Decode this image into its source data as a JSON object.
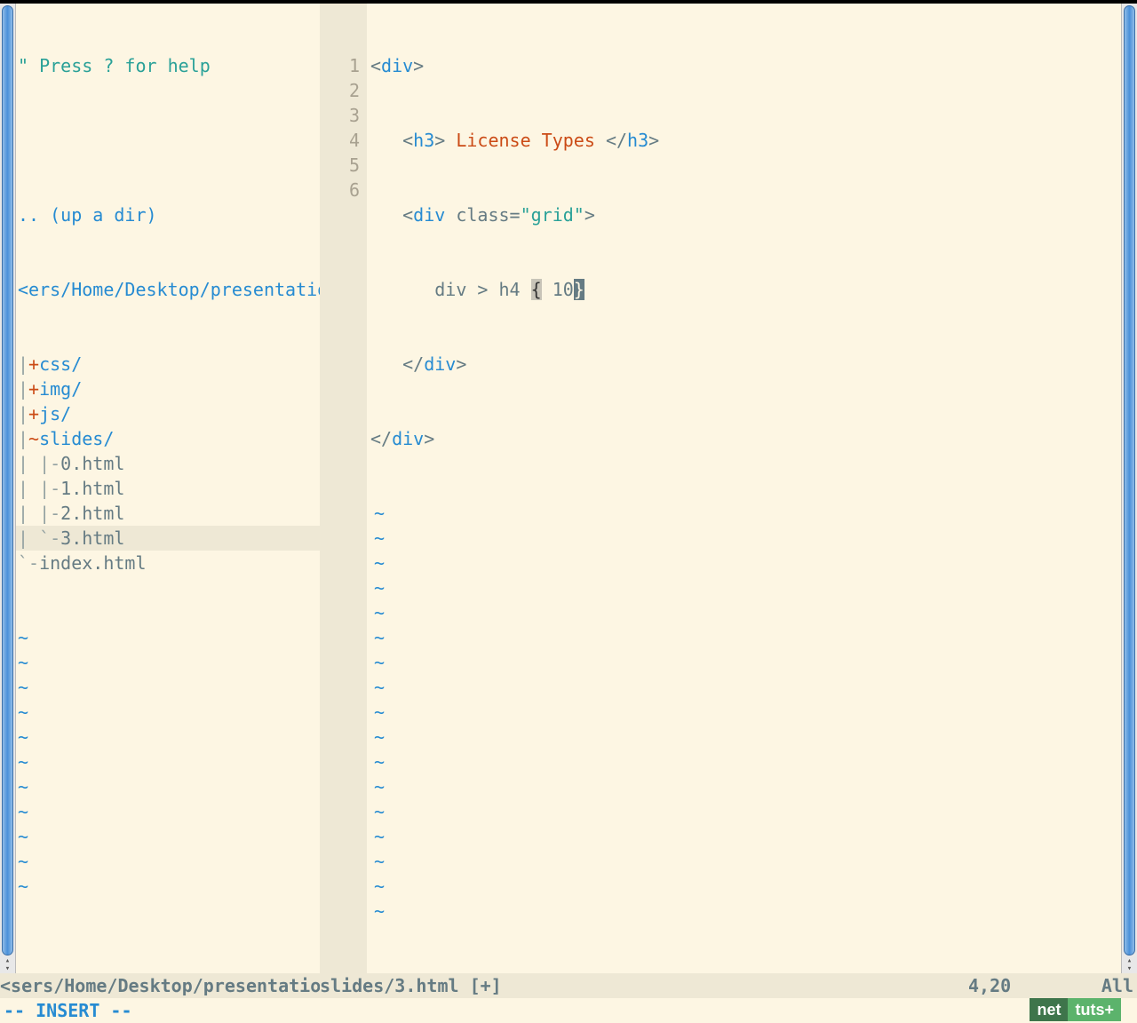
{
  "tree": {
    "help_prefix": "\" ",
    "help_text": "Press ? for help",
    "up_dir": ".. (up a dir)",
    "path": "<ers/Home/Desktop/presentation/",
    "entries": [
      {
        "prefix": "|",
        "glyph": "+",
        "name": "css/",
        "dir": true
      },
      {
        "prefix": "|",
        "glyph": "+",
        "name": "img/",
        "dir": true
      },
      {
        "prefix": "|",
        "glyph": "+",
        "name": "js/",
        "dir": true
      },
      {
        "prefix": "|",
        "glyph": "~",
        "name": "slides/",
        "dir": true
      },
      {
        "prefix": "| |",
        "glyph": "-",
        "name": "0.html",
        "dir": false
      },
      {
        "prefix": "| |",
        "glyph": "-",
        "name": "1.html",
        "dir": false
      },
      {
        "prefix": "| |",
        "glyph": "-",
        "name": "2.html",
        "dir": false
      },
      {
        "prefix": "| `",
        "glyph": "-",
        "name": "3.html",
        "dir": false,
        "selected": true
      },
      {
        "prefix": "`",
        "glyph": "-",
        "name": "index.html",
        "dir": false
      }
    ]
  },
  "code": {
    "heading_text": " License Types ",
    "class_value": "\"grid\"",
    "emmet_left": "div > h4 ",
    "emmet_brace_open": "{",
    "emmet_mid": " 10",
    "emmet_brace_close": "}"
  },
  "line_numbers": [
    "1",
    "2",
    "3",
    "4",
    "5",
    "6"
  ],
  "status": {
    "left": "<sers/Home/Desktop/presentation ",
    "file": "slides/3.html [+]",
    "pos": "4,20",
    "pct": "All"
  },
  "mode": "-- INSERT --",
  "logo": {
    "net": "net",
    "tuts": "tuts+"
  },
  "tilde": "~"
}
